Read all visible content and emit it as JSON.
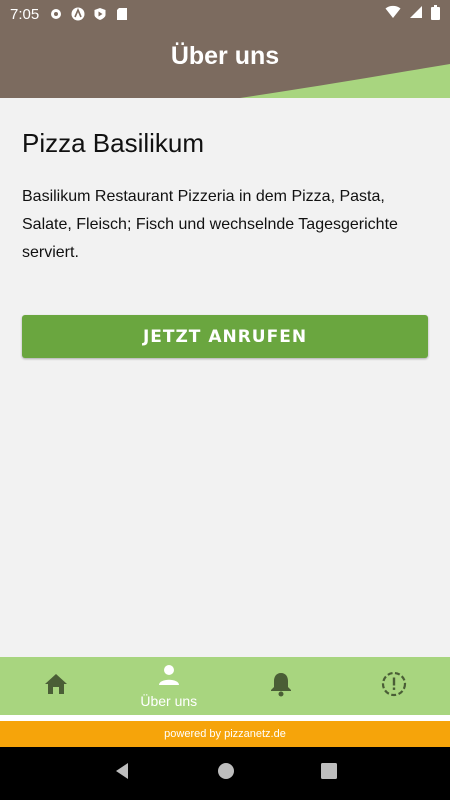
{
  "status_bar": {
    "time": "7:05",
    "left_icons": [
      "gear-icon",
      "a-app-icon",
      "play-shield-icon",
      "sd-card-icon"
    ],
    "right_icons": [
      "wifi-icon",
      "signal-icon",
      "battery-icon"
    ]
  },
  "header": {
    "title": "Über uns"
  },
  "content": {
    "restaurant_name": "Pizza Basilikum",
    "description": "Basilikum Restaurant Pizzeria in dem Pizza, Pasta, Salate, Fleisch; Fisch und wechselnde Tagesgerichte serviert.",
    "call_button_label": "JETZT ANRUFEN"
  },
  "bottom_nav": {
    "items": [
      {
        "icon": "home-icon",
        "label": ""
      },
      {
        "icon": "person-icon",
        "label": "Über uns"
      },
      {
        "icon": "bell-icon",
        "label": ""
      },
      {
        "icon": "alert-circle-icon",
        "label": ""
      }
    ]
  },
  "footer": {
    "powered_by": "powered by pizzanetz.de"
  },
  "colors": {
    "header_bg": "#7c6b5f",
    "accent_green": "#6aa63f",
    "nav_bg": "#a8d57f",
    "footer_orange": "#f6a40a",
    "page_bg": "#f2f2f2"
  }
}
